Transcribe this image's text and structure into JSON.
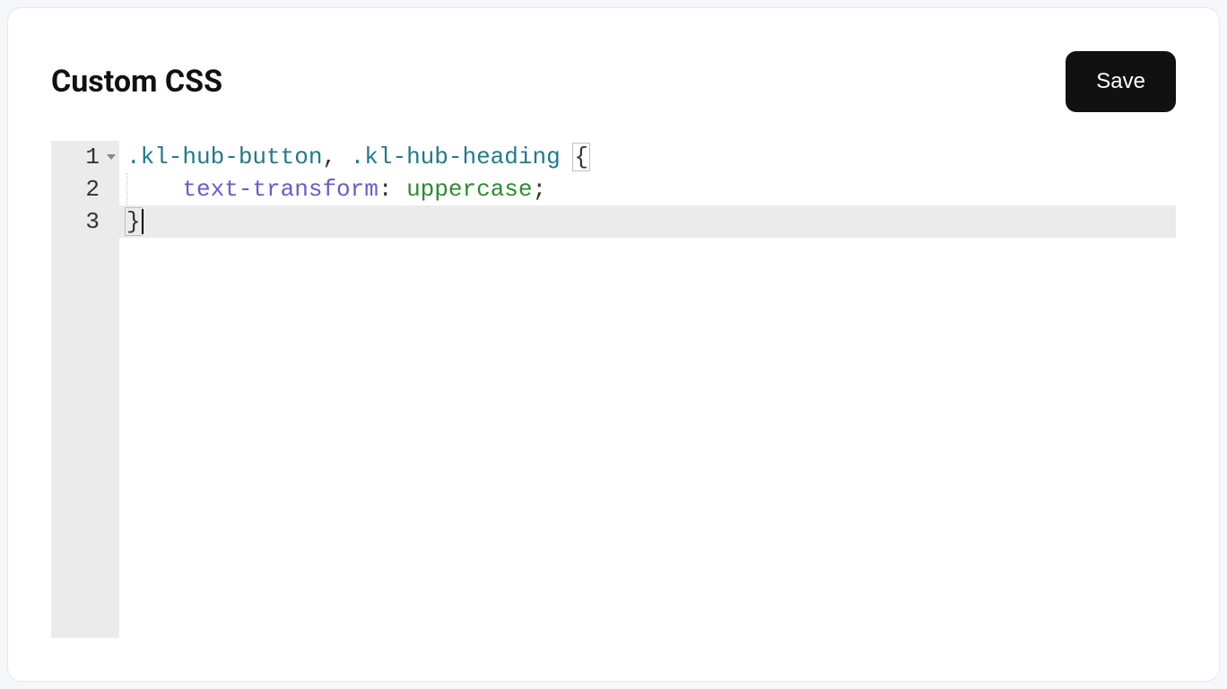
{
  "header": {
    "title": "Custom CSS",
    "save_label": "Save"
  },
  "editor": {
    "gutter": [
      "1",
      "2",
      "3"
    ],
    "active_line_index": 2,
    "fold_lines": [
      0
    ],
    "lines": [
      {
        "tokens": [
          {
            "t": ".kl-hub-button",
            "c": "tok-selector"
          },
          {
            "t": ",",
            "c": "tok-punc"
          },
          {
            "t": " ",
            "c": ""
          },
          {
            "t": ".kl-hub-heading",
            "c": "tok-selector"
          },
          {
            "t": " ",
            "c": ""
          },
          {
            "t": "{",
            "c": "tok-punc brace-match"
          }
        ],
        "indent_guide": false
      },
      {
        "tokens": [
          {
            "t": "    ",
            "c": ""
          },
          {
            "t": "text-transform",
            "c": "tok-prop"
          },
          {
            "t": ":",
            "c": "tok-punc"
          },
          {
            "t": " ",
            "c": ""
          },
          {
            "t": "uppercase",
            "c": "tok-value"
          },
          {
            "t": ";",
            "c": "tok-punc"
          }
        ],
        "indent_guide": true
      },
      {
        "tokens": [
          {
            "t": "}",
            "c": "tok-punc brace-match"
          }
        ],
        "indent_guide": false,
        "cursor_after": true
      }
    ]
  }
}
